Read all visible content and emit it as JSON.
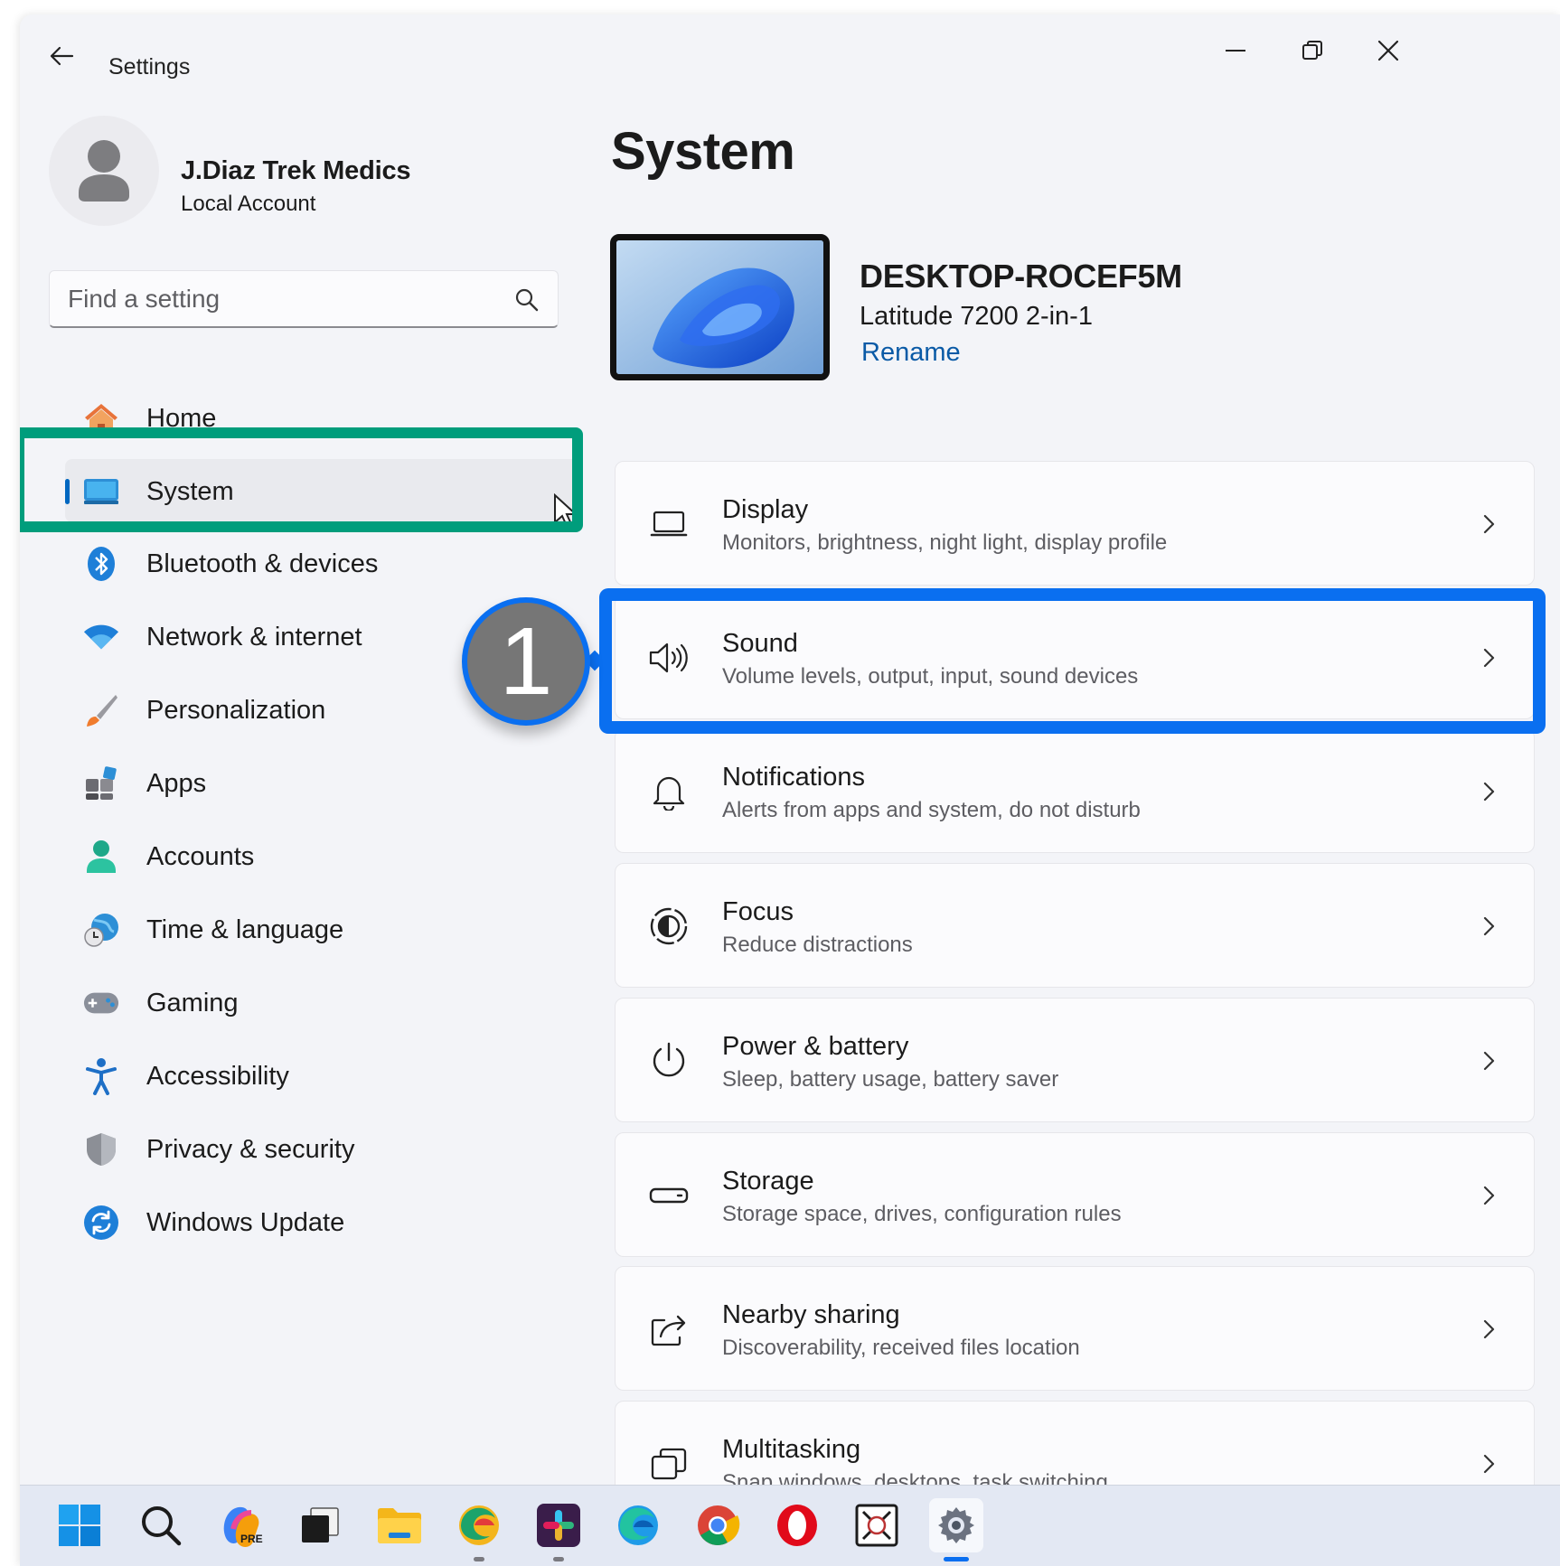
{
  "window": {
    "title": "Settings"
  },
  "user": {
    "name": "J.Diaz Trek Medics",
    "account_type": "Local Account"
  },
  "search": {
    "placeholder": "Find a setting",
    "value": ""
  },
  "nav": {
    "items": [
      {
        "label": "Home",
        "icon": "home-icon"
      },
      {
        "label": "System",
        "icon": "system-icon",
        "selected": true
      },
      {
        "label": "Bluetooth & devices",
        "icon": "bluetooth-icon"
      },
      {
        "label": "Network & internet",
        "icon": "wifi-icon"
      },
      {
        "label": "Personalization",
        "icon": "paintbrush-icon"
      },
      {
        "label": "Apps",
        "icon": "apps-icon"
      },
      {
        "label": "Accounts",
        "icon": "accounts-icon"
      },
      {
        "label": "Time & language",
        "icon": "time-language-icon"
      },
      {
        "label": "Gaming",
        "icon": "gamepad-icon"
      },
      {
        "label": "Accessibility",
        "icon": "accessibility-icon"
      },
      {
        "label": "Privacy & security",
        "icon": "shield-icon"
      },
      {
        "label": "Windows Update",
        "icon": "update-icon"
      }
    ]
  },
  "main": {
    "page_title": "System",
    "device": {
      "name": "DESKTOP-ROCEF5M",
      "model": "Latitude 7200 2-in-1",
      "rename_label": "Rename"
    },
    "cards": [
      {
        "title": "Display",
        "subtitle": "Monitors, brightness, night light, display profile",
        "icon": "display-icon"
      },
      {
        "title": "Sound",
        "subtitle": "Volume levels, output, input, sound devices",
        "icon": "speaker-icon"
      },
      {
        "title": "Notifications",
        "subtitle": "Alerts from apps and system, do not disturb",
        "icon": "bell-icon"
      },
      {
        "title": "Focus",
        "subtitle": "Reduce distractions",
        "icon": "focus-icon"
      },
      {
        "title": "Power & battery",
        "subtitle": "Sleep, battery usage, battery saver",
        "icon": "power-icon"
      },
      {
        "title": "Storage",
        "subtitle": "Storage space, drives, configuration rules",
        "icon": "storage-icon"
      },
      {
        "title": "Nearby sharing",
        "subtitle": "Discoverability, received files location",
        "icon": "share-icon"
      },
      {
        "title": "Multitasking",
        "subtitle": "Snap windows, desktops, task switching",
        "icon": "multitasking-icon"
      }
    ]
  },
  "annotations": {
    "step_number": "1",
    "highlight_colors": {
      "nav": "#009d7c",
      "card": "#0a6ff0"
    }
  },
  "taskbar": {
    "items": [
      "start-icon",
      "search-icon",
      "copilot-pre-icon",
      "task-view-icon",
      "file-explorer-icon",
      "edge-canary-icon",
      "slack-icon",
      "edge-icon",
      "chrome-icon",
      "opera-icon",
      "snipping-icon",
      "settings-icon"
    ],
    "copilot_badge": "PRE"
  },
  "colors": {
    "accent": "#0067c0",
    "link": "#0a5aa6",
    "window_bg": "#f3f4f8"
  }
}
